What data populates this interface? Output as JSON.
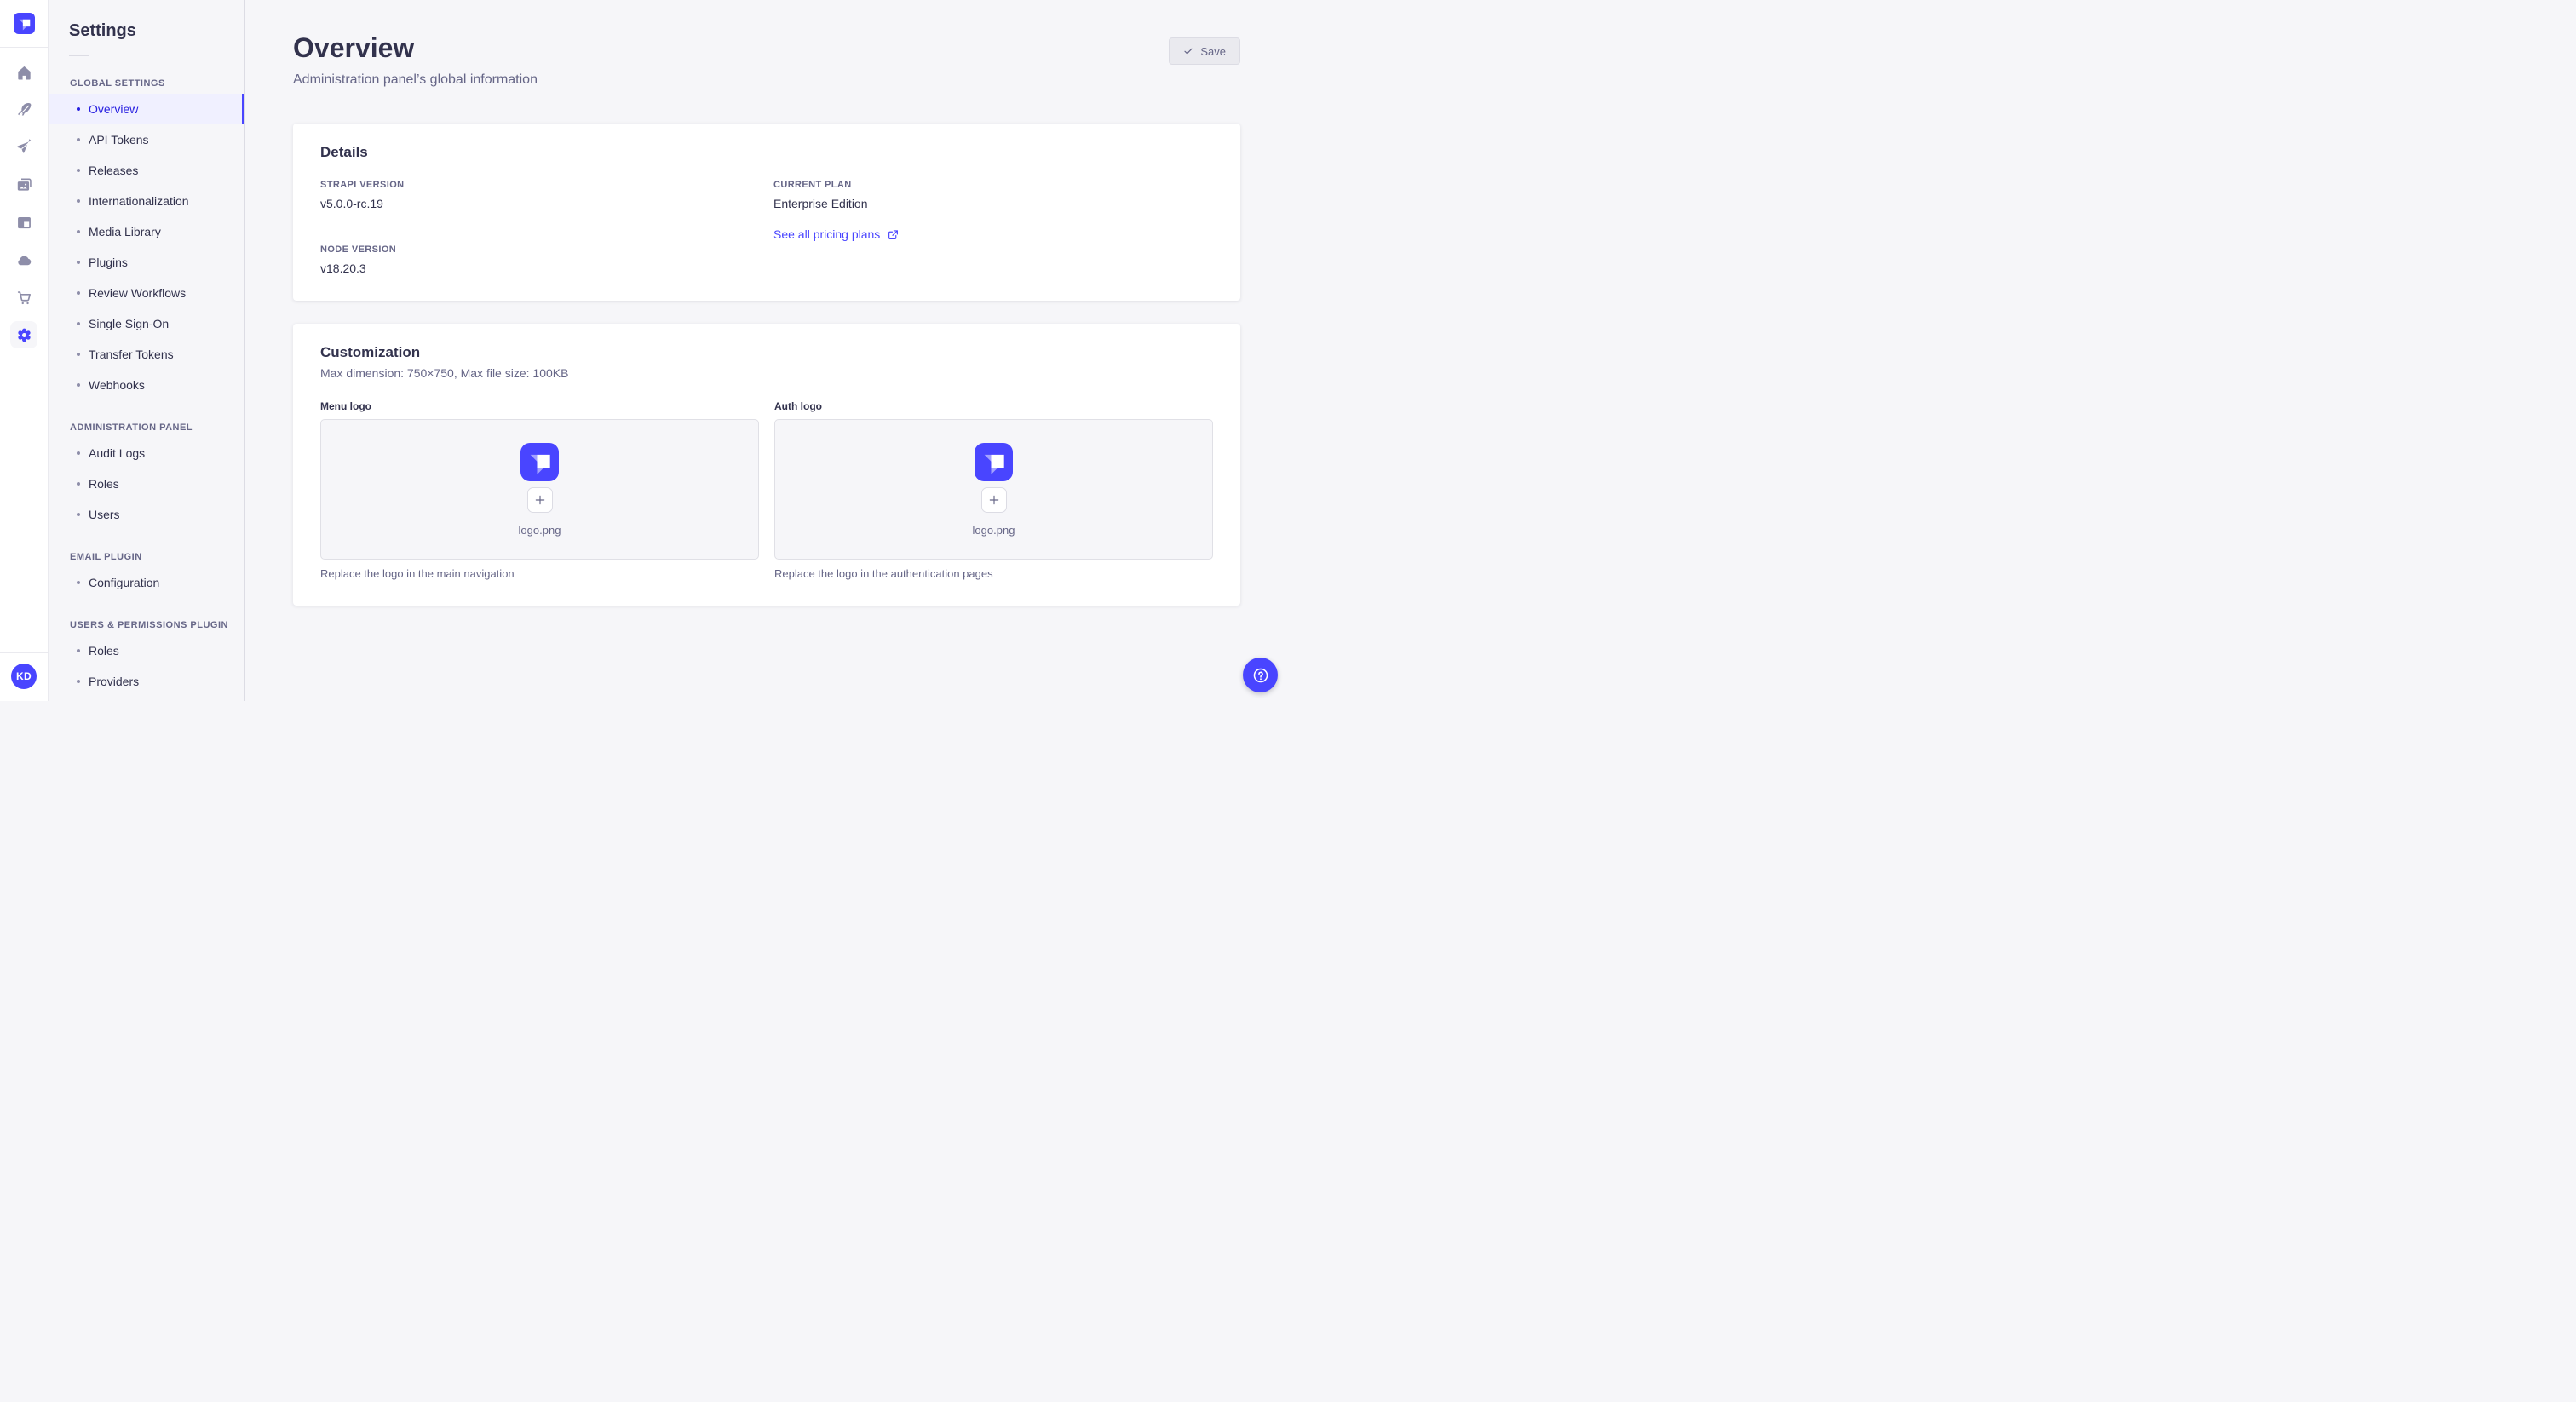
{
  "brand": {
    "primary": "#4945ff",
    "active_text": "#271fe0",
    "active_bg": "#f0f0ff"
  },
  "rail": {
    "avatar_initials": "KD",
    "icons": [
      "home",
      "feather",
      "paper-plane",
      "media-library",
      "layout",
      "cloud",
      "cart",
      "gear"
    ],
    "active_icon": "gear"
  },
  "subnav": {
    "title": "Settings",
    "sections": [
      {
        "heading": "GLOBAL SETTINGS",
        "items": [
          {
            "label": "Overview",
            "active": true
          },
          {
            "label": "API Tokens"
          },
          {
            "label": "Releases"
          },
          {
            "label": "Internationalization"
          },
          {
            "label": "Media Library"
          },
          {
            "label": "Plugins"
          },
          {
            "label": "Review Workflows"
          },
          {
            "label": "Single Sign-On"
          },
          {
            "label": "Transfer Tokens"
          },
          {
            "label": "Webhooks"
          }
        ]
      },
      {
        "heading": "ADMINISTRATION PANEL",
        "items": [
          {
            "label": "Audit Logs"
          },
          {
            "label": "Roles"
          },
          {
            "label": "Users"
          }
        ]
      },
      {
        "heading": "EMAIL PLUGIN",
        "items": [
          {
            "label": "Configuration"
          }
        ]
      },
      {
        "heading": "USERS & PERMISSIONS PLUGIN",
        "items": [
          {
            "label": "Roles"
          },
          {
            "label": "Providers"
          }
        ]
      }
    ]
  },
  "header": {
    "title": "Overview",
    "subtitle": "Administration panel’s global information",
    "save_label": "Save"
  },
  "details_card": {
    "title": "Details",
    "strapi_version": {
      "label": "STRAPI VERSION",
      "value": "v5.0.0-rc.19"
    },
    "node_version": {
      "label": "NODE VERSION",
      "value": "v18.20.3"
    },
    "current_plan": {
      "label": "CURRENT PLAN",
      "value": "Enterprise Edition"
    },
    "pricing_link_label": "See all pricing plans"
  },
  "customization_card": {
    "title": "Customization",
    "subtitle": "Max dimension: 750×750, Max file size: 100KB",
    "logos": [
      {
        "label": "Menu logo",
        "filename": "logo.png",
        "hint": "Replace the logo in the main navigation"
      },
      {
        "label": "Auth logo",
        "filename": "logo.png",
        "hint": "Replace the logo in the authentication pages"
      }
    ]
  }
}
